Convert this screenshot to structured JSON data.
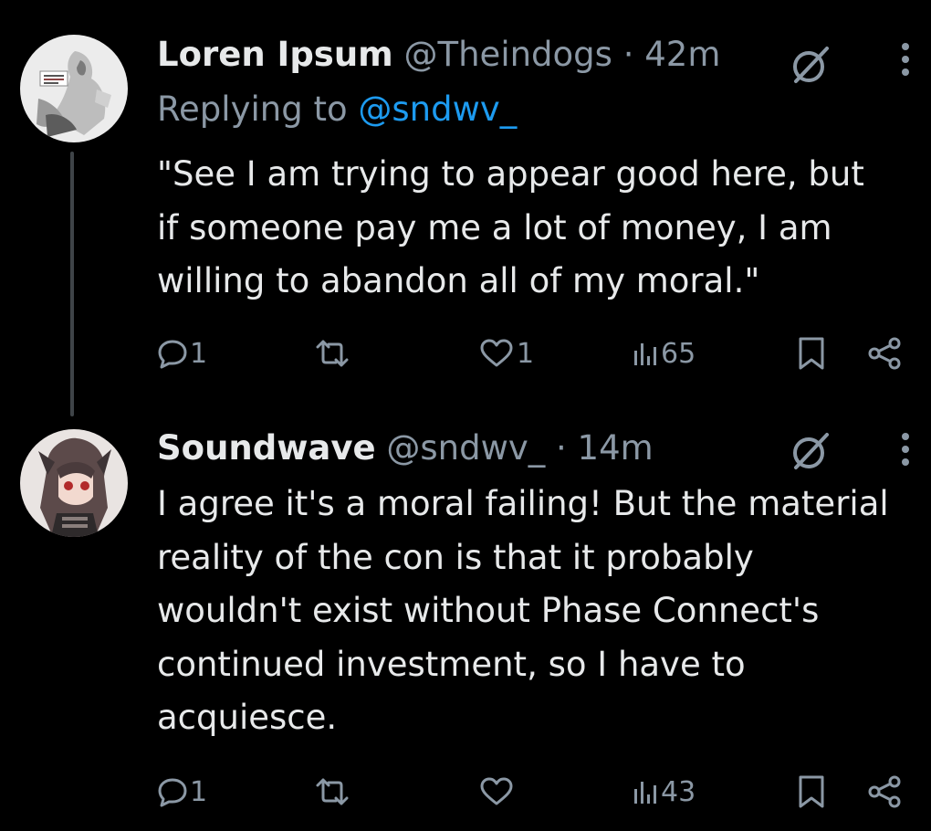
{
  "tweets": [
    {
      "name": "Loren Ipsum",
      "handle": "@Theindogs",
      "separator": "·",
      "time": "42m",
      "reply_prefix": "Replying to",
      "reply_mention": "@sndwv_",
      "lines": [
        "\"See I am trying to appear good here, but",
        "if someone pay me a lot of money, I am",
        "willing to abandon all of my moral.\""
      ],
      "stats": {
        "replies": "1",
        "retweets": "",
        "likes": "1",
        "views": "65"
      }
    },
    {
      "name": "Soundwave",
      "handle": "@sndwv_",
      "separator": "·",
      "time": "14m",
      "lines": [
        "I agree it's a moral failing! But the material",
        "reality of the con is that it probably",
        "wouldn't exist without Phase Connect's",
        "continued investment, so I have to",
        "acquiesce."
      ],
      "stats": {
        "replies": "1",
        "retweets": "",
        "likes": "",
        "views": "43"
      }
    }
  ],
  "icons": {
    "grok": "grok-icon",
    "more": "more-vertical-icon",
    "reply": "reply-icon",
    "retweet": "retweet-icon",
    "like": "heart-icon",
    "views": "views-bar-icon",
    "bookmark": "bookmark-icon",
    "share": "share-icon"
  },
  "colors": {
    "background": "#000000",
    "text": "#e7e9ea",
    "muted": "#8b98a5",
    "link": "#1d9bf0",
    "thread_line": "#3f4448"
  }
}
